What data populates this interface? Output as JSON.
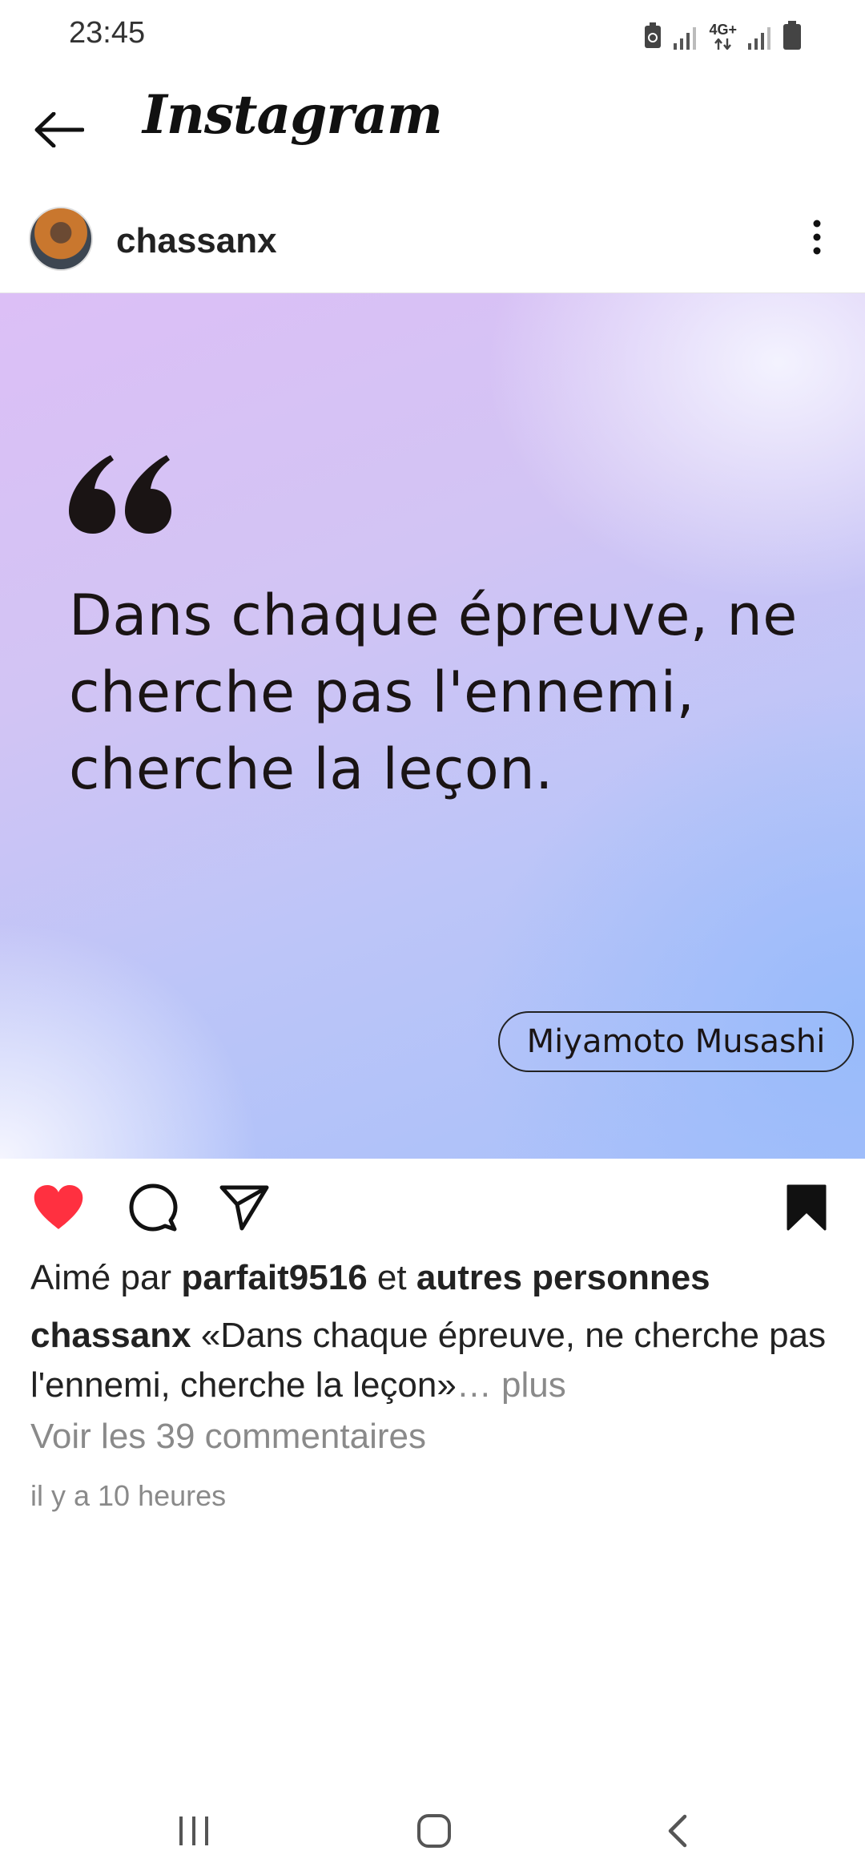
{
  "status_bar": {
    "time": "23:45",
    "network_label": "4G+",
    "icons": [
      "battery-saver-icon",
      "signal-icon",
      "data-arrows-icon",
      "signal-icon-2",
      "battery-icon"
    ]
  },
  "header": {
    "title": "Instagram",
    "back_icon": "arrow-left-icon"
  },
  "post": {
    "username": "chassanx",
    "more_icon": "vertical-dots-icon",
    "image": {
      "quote_text": "Dans chaque épreuve, ne cherche pas l'ennemi, cherche la leçon.",
      "author": "Miyamoto Musashi"
    },
    "actions": {
      "like_icon": "heart-filled-icon",
      "like_color": "#ff3040",
      "comment_icon": "comment-icon",
      "share_icon": "send-icon",
      "save_icon": "bookmark-filled-icon"
    },
    "likes": {
      "prefix": "Aimé par",
      "user": "parfait9516",
      "joiner": "et",
      "others": "autres personnes"
    },
    "caption": {
      "user": "chassanx",
      "text": "«Dans chaque épreuve, ne cherche pas l'ennemi, cherche la leçon»",
      "more": "… plus"
    },
    "comments_link": "Voir les 39 commentaires",
    "timestamp": "il y a 10 heures"
  },
  "nav_bar": {
    "recents_icon": "recents-icon",
    "home_icon": "home-icon",
    "back_icon": "back-chevron-icon"
  }
}
